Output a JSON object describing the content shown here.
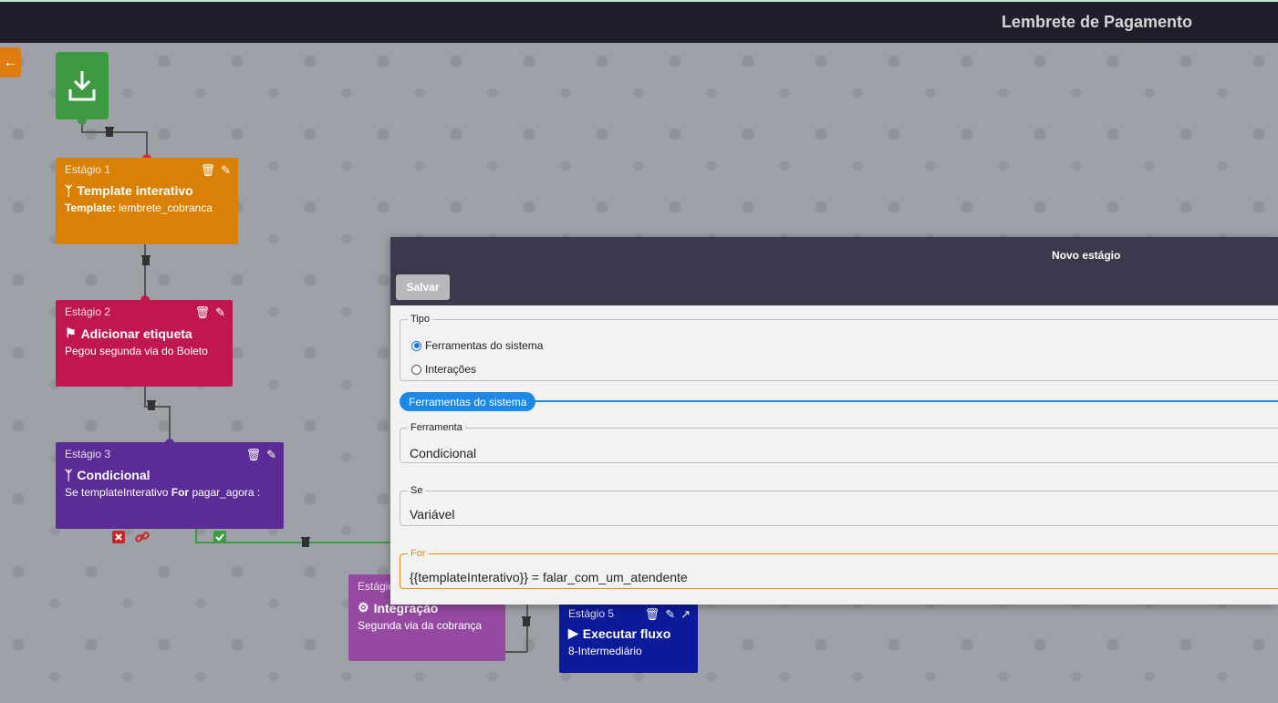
{
  "header": {
    "title": "Lembrete de Pagamento"
  },
  "flow": {
    "nodes": [
      {
        "stage": "Estágio 1",
        "name": "Template interativo",
        "desc_label": "Template:",
        "desc_value": "lembrete_cobranca"
      },
      {
        "stage": "Estágio 2",
        "name": "Adicionar etiqueta",
        "desc": "Pegou segunda via do Boleto"
      },
      {
        "stage": "Estágio 3",
        "name": "Condicional",
        "desc_prefix": "Se templateInterativo",
        "desc_kw": "For",
        "desc_suffix": "pagar_agora :"
      },
      {
        "stage": "Estágio",
        "name": "Integração",
        "desc": "Segunda via da cobrança"
      },
      {
        "stage": "Estágio 5",
        "name": "Executar fluxo",
        "desc": "8-Intermediário"
      }
    ],
    "colors": {
      "start": "#3d9a40",
      "n1": "#d98006",
      "n2": "#c0184e",
      "n3": "#5b2b96",
      "n4": "#944aa0",
      "n5": "#0d1a9a"
    }
  },
  "modal": {
    "title": "Novo estágio",
    "save_label": "Salvar",
    "tipo": {
      "legend": "Tipo",
      "options": [
        "Ferramentas do sistema",
        "Interações"
      ],
      "selected": "Ferramentas do sistema"
    },
    "section_label": "Ferramentas do sistema",
    "ferramenta": {
      "legend": "Ferramenta",
      "value": "Condicional"
    },
    "se": {
      "legend": "Se",
      "value": "Variável"
    },
    "for": {
      "legend": "For",
      "value": "{{templateInterativo}} = falar_com_um_atendente"
    }
  }
}
